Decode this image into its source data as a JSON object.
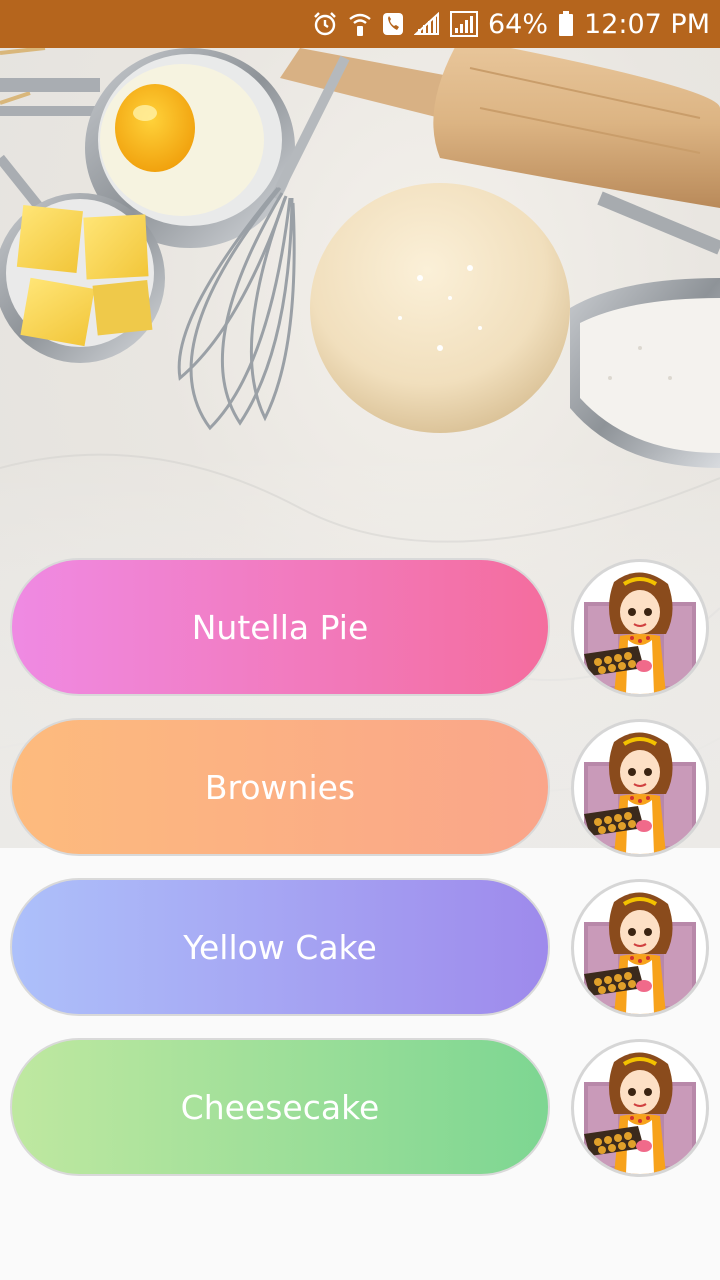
{
  "status_bar": {
    "battery": "64%",
    "time": "12:07 PM",
    "icons": [
      "alarm-icon",
      "wifi-call-icon",
      "phone-icon",
      "signal-icon",
      "signal-box-icon",
      "battery-icon"
    ]
  },
  "hero": {
    "image": "baking-ingredients-photo",
    "items": [
      "egg-bowl",
      "butter-cubes",
      "whisk",
      "dough",
      "rolling-pin",
      "flour-scoop"
    ]
  },
  "recipes": [
    {
      "label": "Nutella Pie",
      "colors": [
        "#ef8ae3",
        "#f46d9e"
      ],
      "avatar": "chef-girl-icon"
    },
    {
      "label": "Brownies",
      "colors": [
        "#fdbb7d",
        "#faa58a"
      ],
      "avatar": "chef-girl-icon"
    },
    {
      "label": "Yellow Cake",
      "colors": [
        "#adc0fa",
        "#9e8aec"
      ],
      "avatar": "chef-girl-icon"
    },
    {
      "label": "Cheesecake",
      "colors": [
        "#bfe8a0",
        "#7dd692"
      ],
      "avatar": "chef-girl-icon"
    }
  ],
  "colors": {
    "status_bar_bg": "#b5651d",
    "page_bg": "#fafafa"
  }
}
